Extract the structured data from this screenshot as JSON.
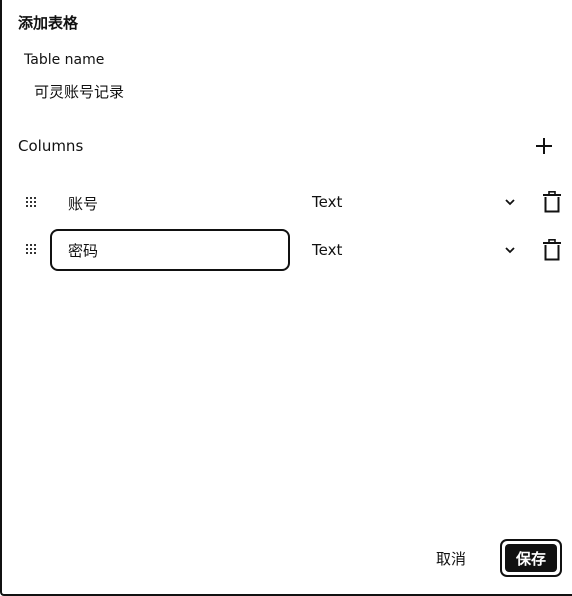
{
  "dialog": {
    "title": "添加表格"
  },
  "table_name": {
    "label": "Table name",
    "value": "可灵账号记录"
  },
  "columns": {
    "label": "Columns",
    "add_icon": "plus-icon",
    "rows": [
      {
        "name": "账号",
        "type": "Text",
        "editing": false
      },
      {
        "name": "密码",
        "type": "Text",
        "editing": true
      }
    ]
  },
  "icons": {
    "drag": "drag-handle-icon",
    "dropdown": "chevron-down-icon",
    "delete": "trash-icon"
  },
  "footer": {
    "cancel_label": "取消",
    "save_label": "保存"
  }
}
